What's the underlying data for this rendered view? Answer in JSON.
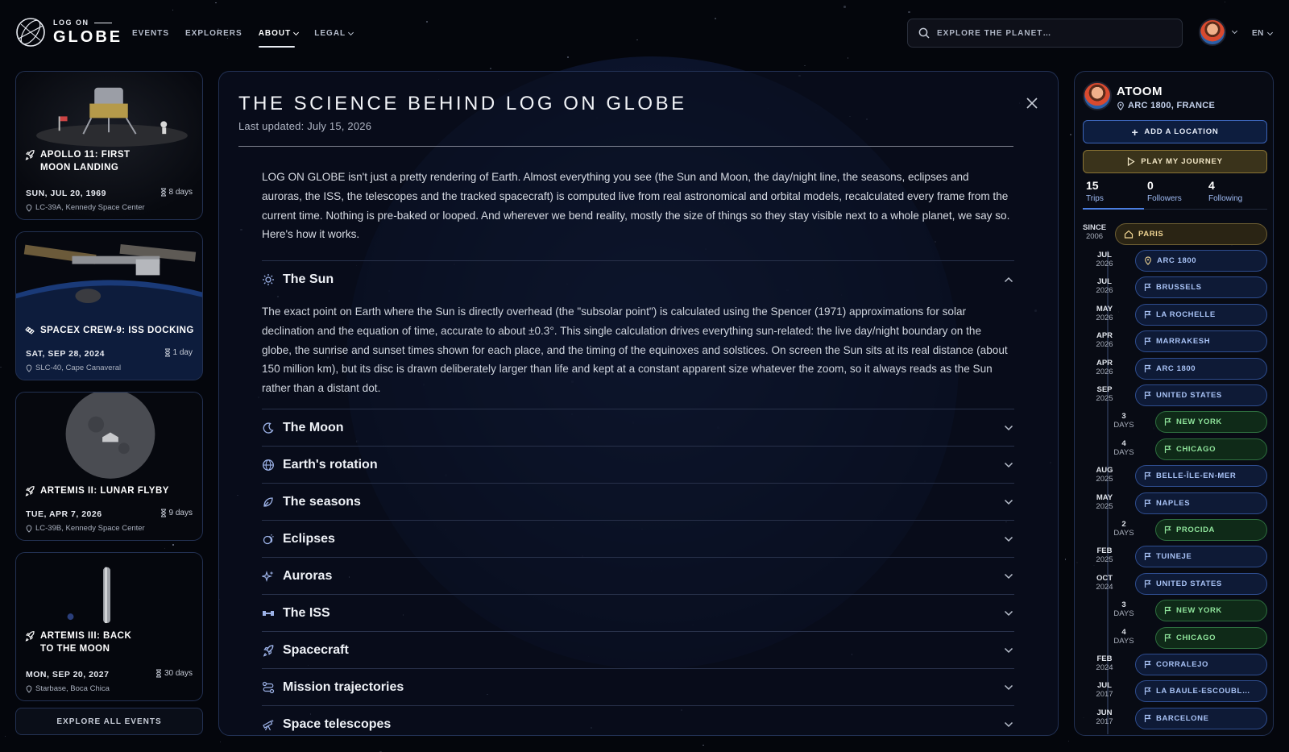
{
  "header": {
    "logo_small": "LOG ON",
    "logo_big": "GLOBE",
    "nav": [
      {
        "label": "EVENTS",
        "dropdown": false,
        "active": false
      },
      {
        "label": "EXPLORERS",
        "dropdown": false,
        "active": false
      },
      {
        "label": "ABOUT",
        "dropdown": true,
        "active": true
      },
      {
        "label": "LEGAL",
        "dropdown": true,
        "active": false
      }
    ],
    "search_placeholder": "EXPLORE THE PLANET…",
    "language": "EN"
  },
  "events": [
    {
      "title": "APOLLO 11: FIRST MOON LANDING",
      "title_lines": [
        "APOLLO 11: FIRST",
        "MOON LANDING"
      ],
      "date": "SUN, JUL 20, 1969",
      "duration": "8 days",
      "location": "LC-39A, Kennedy Space Center",
      "icon": "rocket-icon"
    },
    {
      "title": "SPACEX CREW-9: ISS DOCKING",
      "title_lines": [
        "SPACEX CREW-9: ISS DOCKING"
      ],
      "date": "SAT, SEP 28, 2024",
      "duration": "1 day",
      "location": "SLC-40, Cape Canaveral",
      "icon": "satellite-icon"
    },
    {
      "title": "ARTEMIS II: LUNAR FLYBY",
      "title_lines": [
        "ARTEMIS II: LUNAR FLYBY"
      ],
      "date": "TUE, APR 7, 2026",
      "duration": "9 days",
      "location": "LC-39B, Kennedy Space Center",
      "icon": "rocket-icon"
    },
    {
      "title": "ARTEMIS III: BACK TO THE MOON",
      "title_lines": [
        "ARTEMIS III: BACK",
        "TO THE MOON"
      ],
      "date": "MON, SEP 20, 2027",
      "duration": "30 days",
      "location": "Starbase, Boca Chica",
      "icon": "rocket-icon"
    }
  ],
  "explore_all_label": "EXPLORE ALL EVENTS",
  "modal": {
    "title": "THE SCIENCE BEHIND LOG ON GLOBE",
    "updated": "Last updated: July 15, 2026",
    "intro": "LOG ON GLOBE isn't just a pretty rendering of Earth. Almost everything you see (the Sun and Moon, the day/night line, the seasons, eclipses and auroras, the ISS, the telescopes and the tracked spacecraft) is computed live from real astronomical and orbital models, recalculated every frame from the current time. Nothing is pre-baked or looped. And wherever we bend reality, mostly the size of things so they stay visible next to a whole planet, we say so. Here's how it works.",
    "sections": [
      {
        "label": "The Sun",
        "icon": "sun-icon",
        "expanded": true,
        "body": "The exact point on Earth where the Sun is directly overhead (the \"subsolar point\") is calculated using the Spencer (1971) approximations for solar declination and the equation of time, accurate to about ±0.3°. This single calculation drives everything sun-related: the live day/night boundary on the globe, the sunrise and sunset times shown for each place, and the timing of the equinoxes and solstices. On screen the Sun sits at its real distance (about 150 million km), but its disc is drawn deliberately larger than life and kept at a constant apparent size whatever the zoom, so it always reads as the Sun rather than a distant dot."
      },
      {
        "label": "The Moon",
        "icon": "moon-icon",
        "expanded": false
      },
      {
        "label": "Earth's rotation",
        "icon": "globe-icon",
        "expanded": false
      },
      {
        "label": "The seasons",
        "icon": "leaf-icon",
        "expanded": false
      },
      {
        "label": "Eclipses",
        "icon": "eclipse-icon",
        "expanded": false
      },
      {
        "label": "Auroras",
        "icon": "sparkle-icon",
        "expanded": false
      },
      {
        "label": "The ISS",
        "icon": "iss-icon",
        "expanded": false
      },
      {
        "label": "Spacecraft",
        "icon": "rocket-icon",
        "expanded": false
      },
      {
        "label": "Mission trajectories",
        "icon": "route-icon",
        "expanded": false
      },
      {
        "label": "Space telescopes",
        "icon": "telescope-icon",
        "expanded": false
      }
    ]
  },
  "profile": {
    "name": "ATOOM",
    "location": "ARC 1800, FRANCE",
    "add_location_label": "ADD A LOCATION",
    "play_journey_label": "PLAY MY JOURNEY",
    "stats": [
      {
        "value": "15",
        "label": "Trips",
        "active": true
      },
      {
        "value": "0",
        "label": "Followers",
        "active": false
      },
      {
        "value": "4",
        "label": "Following",
        "active": false
      }
    ],
    "since_label": "SINCE",
    "since_year": "2006",
    "home": "PARIS",
    "trips": [
      {
        "date_top": "JUL",
        "date_bottom": "2026",
        "name": "ARC 1800",
        "kind": "blue",
        "icon": "pin-icon",
        "level": 0
      },
      {
        "date_top": "JUL",
        "date_bottom": "2026",
        "name": "BRUSSELS",
        "kind": "blue",
        "icon": "flag-icon",
        "level": 0
      },
      {
        "date_top": "MAY",
        "date_bottom": "2026",
        "name": "LA ROCHELLE",
        "kind": "blue",
        "icon": "flag-icon",
        "level": 0
      },
      {
        "date_top": "APR",
        "date_bottom": "2026",
        "name": "MARRAKESH",
        "kind": "blue",
        "icon": "flag-icon",
        "level": 0
      },
      {
        "date_top": "APR",
        "date_bottom": "2026",
        "name": "ARC 1800",
        "kind": "blue",
        "icon": "flag-icon",
        "level": 0
      },
      {
        "date_top": "SEP",
        "date_bottom": "2025",
        "name": "UNITED STATES",
        "kind": "blue",
        "icon": "flag-icon",
        "level": 0
      },
      {
        "date_top": "3",
        "date_bottom": "DAYS",
        "name": "NEW YORK",
        "kind": "green",
        "icon": "flag-icon",
        "level": 1
      },
      {
        "date_top": "4",
        "date_bottom": "DAYS",
        "name": "CHICAGO",
        "kind": "green",
        "icon": "flag-icon",
        "level": 1
      },
      {
        "date_top": "AUG",
        "date_bottom": "2025",
        "name": "BELLE-ÎLE-EN-MER",
        "kind": "blue",
        "icon": "flag-icon",
        "level": 0
      },
      {
        "date_top": "MAY",
        "date_bottom": "2025",
        "name": "NAPLES",
        "kind": "blue",
        "icon": "flag-icon",
        "level": 0
      },
      {
        "date_top": "2",
        "date_bottom": "DAYS",
        "name": "PROCIDA",
        "kind": "green",
        "icon": "flag-icon",
        "level": 1
      },
      {
        "date_top": "FEB",
        "date_bottom": "2025",
        "name": "TUINEJE",
        "kind": "blue",
        "icon": "flag-icon",
        "level": 0
      },
      {
        "date_top": "OCT",
        "date_bottom": "2024",
        "name": "UNITED STATES",
        "kind": "blue",
        "icon": "flag-icon",
        "level": 0
      },
      {
        "date_top": "3",
        "date_bottom": "DAYS",
        "name": "NEW YORK",
        "kind": "green",
        "icon": "flag-icon",
        "level": 1
      },
      {
        "date_top": "4",
        "date_bottom": "DAYS",
        "name": "CHICAGO",
        "kind": "green",
        "icon": "flag-icon",
        "level": 1
      },
      {
        "date_top": "FEB",
        "date_bottom": "2024",
        "name": "CORRALEJO",
        "kind": "blue",
        "icon": "flag-icon",
        "level": 0
      },
      {
        "date_top": "JUL",
        "date_bottom": "2017",
        "name": "LA BAULE-ESCOUBL…",
        "kind": "blue",
        "icon": "flag-icon",
        "level": 0
      },
      {
        "date_top": "JUN",
        "date_bottom": "2017",
        "name": "BARCELONE",
        "kind": "blue",
        "icon": "flag-icon",
        "level": 0
      }
    ]
  },
  "colors": {
    "background": "#04060c",
    "panel_border": "#223154",
    "accent_blue": "#3b63b6",
    "accent_gold": "#8a7434",
    "trip_green": "#2e6f3f"
  }
}
